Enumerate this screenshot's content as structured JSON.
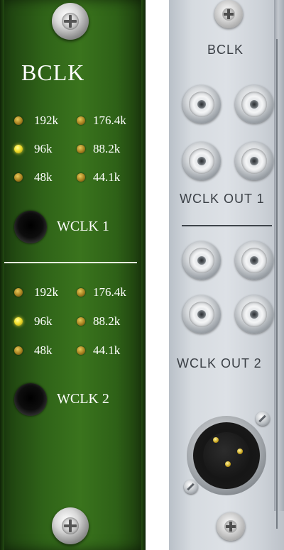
{
  "front": {
    "title": "BCLK",
    "group1": {
      "rows": [
        {
          "left": "192k",
          "right": "176.4k",
          "left_on": false,
          "right_on": false
        },
        {
          "left": "96k",
          "right": "88.2k",
          "left_on": true,
          "right_on": false
        },
        {
          "left": "48k",
          "right": "44.1k",
          "left_on": false,
          "right_on": false
        }
      ],
      "jack_label": "WCLK 1"
    },
    "group2": {
      "rows": [
        {
          "left": "192k",
          "right": "176.4k",
          "left_on": false,
          "right_on": false
        },
        {
          "left": "96k",
          "right": "88.2k",
          "left_on": true,
          "right_on": false
        },
        {
          "left": "48k",
          "right": "44.1k",
          "left_on": false,
          "right_on": false
        }
      ],
      "jack_label": "WCLK 2"
    }
  },
  "rear": {
    "bclk_label": "BCLK",
    "out1_label": "WCLK OUT 1",
    "out2_label": "WCLK OUT 2"
  },
  "colors": {
    "panel_green": "#356b1a",
    "led_on": "#f1e02e",
    "led_off": "#a6801f",
    "rear_metal": "#d6dbe0"
  },
  "icons": [
    "panel-screw-icon",
    "led-indicator-icon",
    "bnc-connector-icon",
    "xlr-connector-icon",
    "jack-socket-icon"
  ]
}
